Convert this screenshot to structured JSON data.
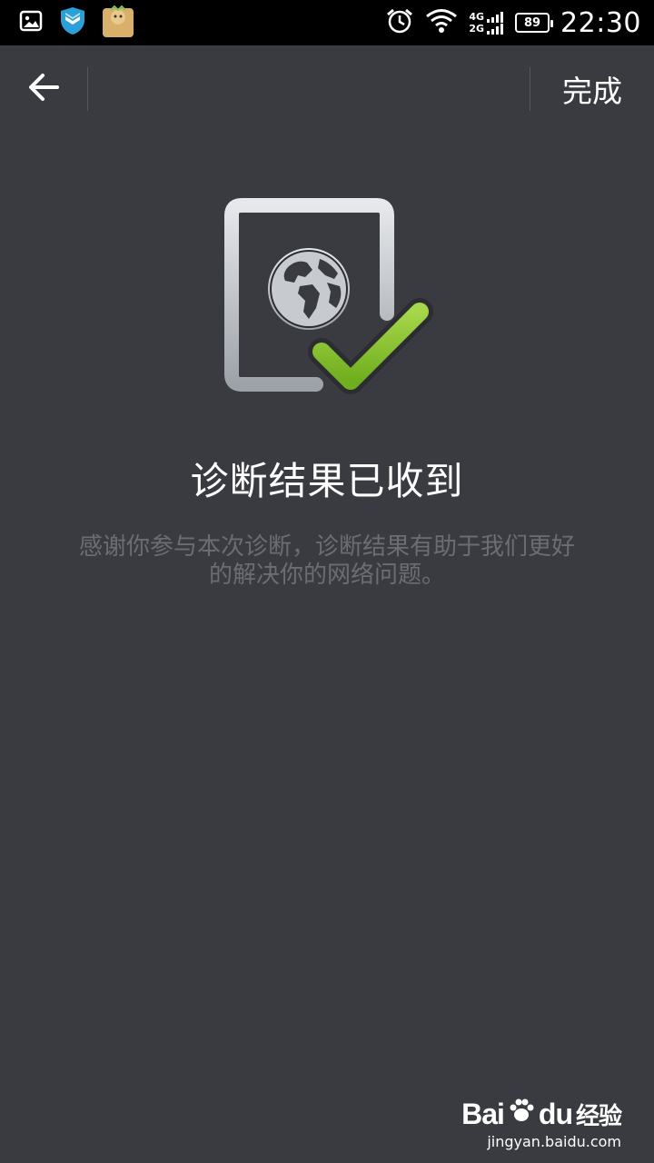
{
  "status_bar": {
    "net_top": "4G",
    "net_bottom": "2G",
    "battery": "89",
    "time": "22:30",
    "icons": [
      "image-notification-icon",
      "shield-notification-icon",
      "app-notification-icon",
      "alarm-icon",
      "wifi-icon",
      "signal-icon",
      "battery-icon"
    ]
  },
  "action_bar": {
    "back_icon": "arrow-left-icon",
    "done_label": "完成"
  },
  "result": {
    "illustration_icon": "globe-document-check-icon",
    "title": "诊断结果已收到",
    "description": "感谢你参与本次诊断，诊断结果有助于我们更好的解决你的网络问题。"
  },
  "watermark": {
    "logo_text": "Bai",
    "logo_suffix": "du",
    "logo_cn": "经验",
    "url": "jingyan.baidu.com"
  },
  "colors": {
    "background": "#3a3b41",
    "status_bar": "#000000",
    "check_green": "#8cc63f",
    "frame_gray": "#b8bcc2",
    "desc_text": "#6c6d72"
  }
}
